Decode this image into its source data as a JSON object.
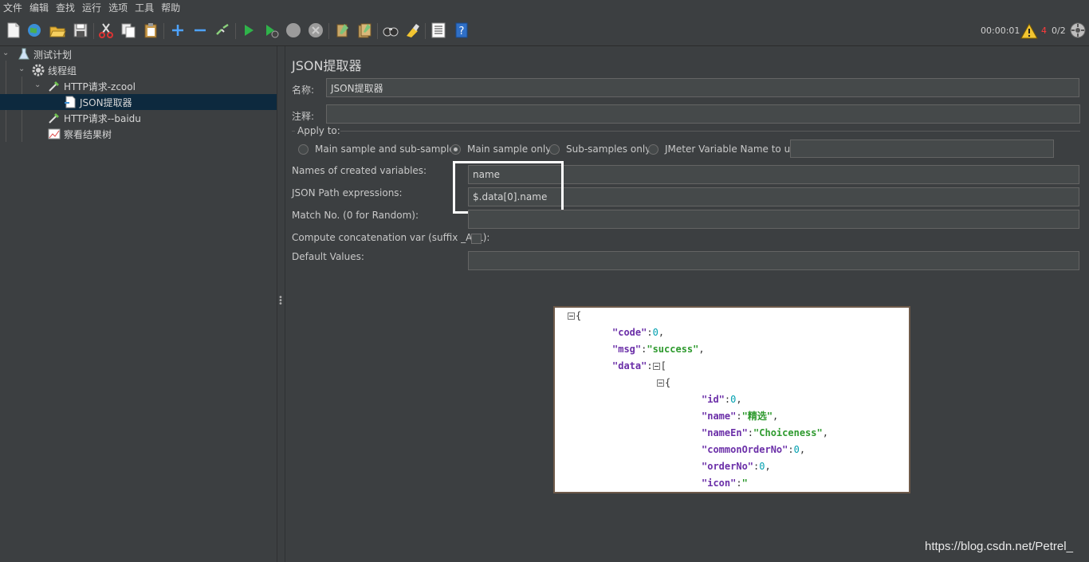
{
  "menu": [
    "文件",
    "编辑",
    "查找",
    "运行",
    "选项",
    "工具",
    "帮助"
  ],
  "toolbar": {
    "timer": "00:00:01",
    "warning_count": "4",
    "threads": "0/2",
    "icons": [
      "new-icon",
      "templates-icon",
      "open-icon",
      "save-icon",
      "cut-icon",
      "copy-icon",
      "paste-icon",
      "expand-icon",
      "collapse-icon",
      "toggle-icon",
      "start-icon",
      "start-no-pause-icon",
      "stop-icon",
      "shutdown-icon",
      "clear-icon",
      "clear-all-icon",
      "search-icon",
      "reset-search-icon",
      "function-helper-icon",
      "help-icon"
    ]
  },
  "tree": {
    "items": [
      {
        "label": "测试计划",
        "icon": "test-plan-icon"
      },
      {
        "label": "线程组",
        "icon": "gear-icon"
      },
      {
        "label": "HTTP请求-zcool",
        "icon": "sampler-pipette-icon"
      },
      {
        "label": "JSON提取器",
        "icon": "extractor-icon"
      },
      {
        "label": "HTTP请求--baidu",
        "icon": "sampler-pipette-icon"
      },
      {
        "label": "察看结果树",
        "icon": "listener-chart-icon"
      }
    ]
  },
  "panel": {
    "title": "JSON提取器",
    "name_label": "名称:",
    "name_value": "JSON提取器",
    "comment_label": "注释:",
    "comment_value": "",
    "apply_to_label": "Apply to:",
    "apply_options": [
      "Main sample and sub-samples",
      "Main sample only",
      "Sub-samples only",
      "JMeter Variable Name to use"
    ],
    "apply_selected": "Main sample only",
    "jmeter_var_value": "",
    "names_label": "Names of created variables:",
    "names_value": "name",
    "jsonpath_label": "JSON Path expressions:",
    "jsonpath_value": "$.data[0].name",
    "matchno_label": "Match No. (0 for Random):",
    "matchno_value": "",
    "concat_label": "Compute concatenation var (suffix _ALL):",
    "concat_checked": false,
    "default_label": "Default Values:",
    "default_value": ""
  },
  "json_preview": {
    "lines": [
      {
        "open": "{"
      },
      {
        "key": "\"code\"",
        "num": "0"
      },
      {
        "key": "\"msg\"",
        "str": "\"success\""
      },
      {
        "key": "\"data\"",
        "open": "["
      },
      {
        "open": "{"
      },
      {
        "key": "\"id\"",
        "num": "0"
      },
      {
        "key": "\"name\"",
        "str": "\"精选\""
      },
      {
        "key": "\"nameEn\"",
        "str": "\"Choiceness\""
      },
      {
        "key": "\"commonOrderNo\"",
        "num": "0"
      },
      {
        "key": "\"orderNo\"",
        "num": "0"
      },
      {
        "key": "\"icon\"",
        "str": "\""
      }
    ]
  },
  "watermark": "https://blog.csdn.net/Petrel_"
}
